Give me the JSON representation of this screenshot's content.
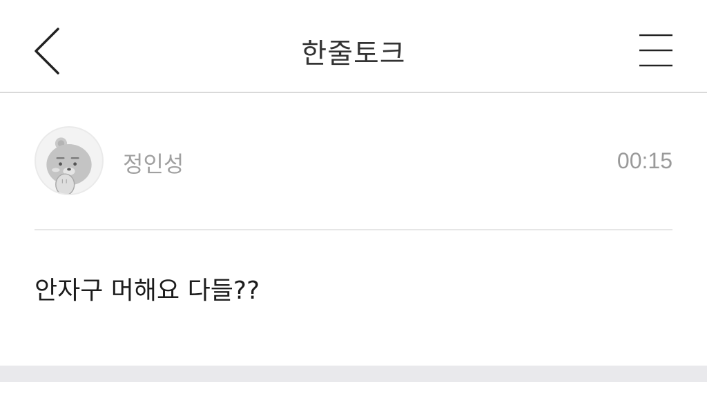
{
  "header": {
    "title": "한줄토크",
    "back_icon": "chevron-left-icon",
    "menu_icon": "hamburger-menu-icon"
  },
  "post": {
    "author": "정인성",
    "time": "00:15",
    "avatar_icon": "bear-character-avatar",
    "message": "안자구 머해요 다들??"
  },
  "colors": {
    "divider": "#d9d9d9",
    "meta_text": "#a0a0a0",
    "footer_bar": "#e9e9ec"
  }
}
